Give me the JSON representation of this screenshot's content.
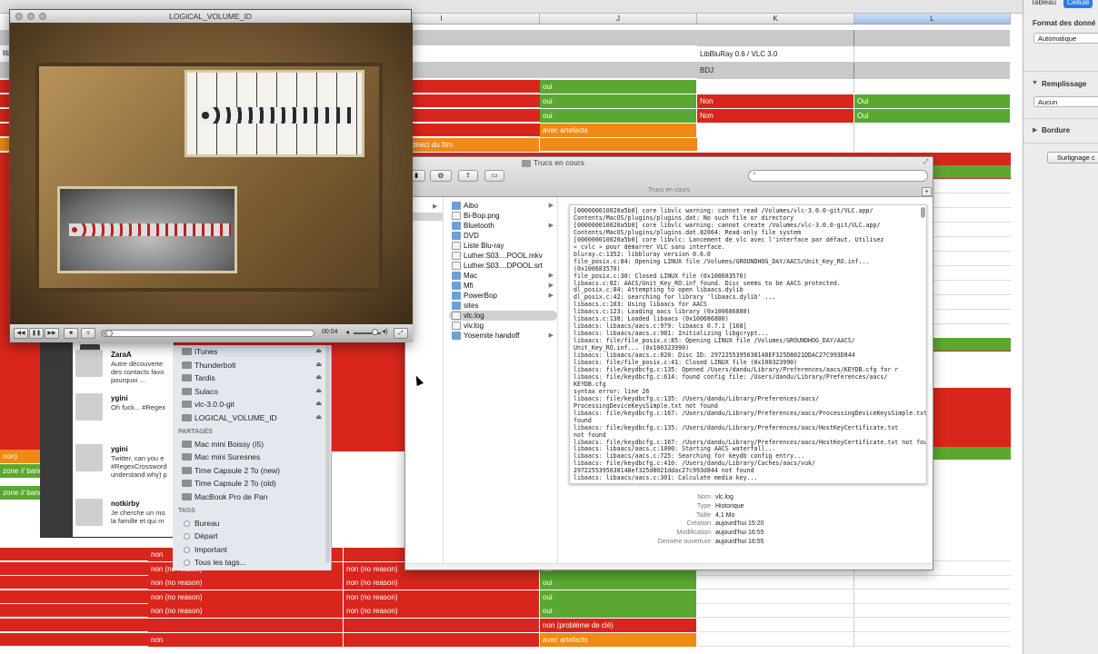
{
  "spreadsheet": {
    "columns": [
      "I",
      "J",
      "K",
      "L"
    ],
    "header_rows": {
      "libbluray_label": "LibBluRay 0.6 / VLC 3.0",
      "bdj_label": "BDJ",
      "lib_fragment": "lib"
    },
    "j_cells": [
      "oui",
      "oui",
      "oui",
      "avec artefacts"
    ],
    "i_cell_direct": "direct du film",
    "k_cells": [
      "Non",
      "Non"
    ],
    "l_cells": [
      "Oui",
      "Oui"
    ],
    "left_fragments": [
      "non)",
      "zone // bande",
      "zone // bande"
    ],
    "bottom_rows": [
      {
        "h": "non",
        "i": "",
        "j": "oui"
      },
      {
        "h": "non (no reason)",
        "i": "non (no reason)",
        "j": "oui"
      },
      {
        "h": "non (no reason)",
        "i": "non (no reason)",
        "j": "oui"
      },
      {
        "h": "non (no reason)",
        "i": "non (no reason)",
        "j": "oui"
      },
      {
        "h": "non (no reason)",
        "i": "non (no reason)",
        "j": "oui"
      },
      {
        "h": "",
        "i": "",
        "j": "non (problème de clé)"
      },
      {
        "h": "non",
        "i": "",
        "j": "avec artefacts"
      }
    ]
  },
  "inspector": {
    "tabs": [
      "Tableau",
      "Cellule"
    ],
    "data_format_label": "Format des donné",
    "data_format_value": "Automatique",
    "fill_label": "Remplissage",
    "fill_value": "Aucun",
    "border_label": "Bordure",
    "highlight_button": "Surlignage c"
  },
  "vlc": {
    "title": "LOGICAL_VOLUME_ID",
    "time": "00:04",
    "progress": 0.02
  },
  "finder": {
    "title": "Trucs en cours",
    "path_label": "Trucs en cours",
    "search_placeholder": "",
    "items": [
      {
        "name": "Aibo",
        "folder": true,
        "arrow": true
      },
      {
        "name": "Bi-Bop.png",
        "folder": false
      },
      {
        "name": "Bluetooth",
        "folder": true,
        "arrow": true
      },
      {
        "name": "DVD",
        "folder": true
      },
      {
        "name": "Liste Blu-ray",
        "folder": false
      },
      {
        "name": "Luther.S03....POOL.mkv",
        "folder": false
      },
      {
        "name": "Luther.S03....DPOOL.srt",
        "folder": false
      },
      {
        "name": "Mac",
        "folder": true,
        "arrow": true
      },
      {
        "name": "Mfi",
        "folder": true,
        "arrow": true
      },
      {
        "name": "PowerBop",
        "folder": true,
        "arrow": true
      },
      {
        "name": "sites",
        "folder": true
      },
      {
        "name": "vlc.log",
        "folder": false,
        "selected": true
      },
      {
        "name": "viv.log",
        "folder": false
      },
      {
        "name": "Yosemite handoff",
        "folder": true,
        "arrow": true
      }
    ],
    "log_lines": [
      "[000000010020a5b0] core libvlc warning: cannot read /Volumes/vlc-3.0.0-git/VLC.app/",
      "Contents/MacOS/plugins/plugins.dat: No such file or directory",
      "[000000010020a5b0] core libvlc warning: cannot create /Volumes/vlc-3.0.0-git/VLC.app/",
      "Contents/MacOS/plugins/plugins.dat.82064: Read-only file system",
      "[000000010020a5b0] core libvlc: Lancement de vlc avec l'interface par défaut. Utilisez",
      "« cvlc » pour démarrer VLC sans interface.",
      "bluray.c:1352: libbluray version 0.6.0",
      "file_posix.c:84: Opening LINUX file /Volumes/GROUNDHOG_DAY/AACS/Unit_Key_RO.inf...",
      "(0x100683570)",
      "file_posix.c:30: Closed LINUX file (0x100683570)",
      "libaacs.c:82: AACS/Unit_Key_RO.inf found. Disc seems to be AACS protected.",
      "dl_posix.c:84: Attempting to open libaacs.dylib",
      "dl_posix.c:42: searching for library 'libaacs.dylib' ...",
      "libaacs.c:103: Using libaacs for AACS",
      "libaacs.c:123: Loading aacs library (0x100686880)",
      "libaacs.c:138: Loaded libaacs (0x100686880)",
      "libaacs: libaacs/aacs.c:979: libaacs 0.7.1 [168]",
      "libaacs: libaacs/aacs.c:981: Initializing libgcrypt...",
      "libaacs: file/file_posix.c:85: Opening LINUX file /Volumes/GROUNDHOG_DAY/AACS/",
      "Unit_Key_RO.inf... (0x100323990)",
      "libaacs: libaacs/aacs.c:820: Disc ID: 2972255395638148EF325D8021DDAC27C993D844",
      "libaacs: file/file_posix.c:41: Closed LINUX file (0x100323990)",
      "libaacs: file/keydbcfg.c:135: Opened /Users/dandu/Library/Preferences/aacs/KEYDB.cfg for r",
      "libaacs: file/keydbcfg.c:614: found config file: /Users/dandu/Library/Preferences/aacs/",
      "KEYDB.cfg",
      "syntax error: line 26",
      "libaacs: file/keydbcfg.c:135: /Users/dandu/Library/Preferences/aacs/",
      "ProcessingDeviceKeysSimple.txt not found",
      "libaacs: file/keydbcfg.c:167: /Users/dandu/Library/Preferences/aacs/ProcessingDeviceKeysSimple.txt not",
      "found",
      "libaacs: file/keydbcfg.c:135: /Users/dandu/Library/Preferences/aacs/HostKeyCertificate.txt",
      "not found",
      "libaacs: file/keydbcfg.c:167: /Users/dandu/Library/Preferences/aacs/HostKeyCertificate.txt not found",
      "libaacs: libaacs/aacs.c:1000: Starting AACS waterfall...",
      "libaacs: libaacs/aacs.c:725: Searching for keydb config entry...",
      "libaacs: file/keydbcfg.c:410: /Users/dandu/Library/Caches/aacs/vuk/",
      "2972255395638148ef325d8021ddac27c993d844 not found",
      "libaacs: libaacs/aacs.c:301: Calculate media key..."
    ],
    "info": [
      {
        "label": "Nom",
        "value": "vlc.log"
      },
      {
        "label": "Type",
        "value": "Historique"
      },
      {
        "label": "Taille",
        "value": "4,1 Mo"
      },
      {
        "label": "Création",
        "value": "aujourd'hui 15:20"
      },
      {
        "label": "Modification",
        "value": "aujourd'hui 16:55"
      },
      {
        "label": "Dernière ouverture",
        "value": "aujourd'hui 16:55"
      }
    ]
  },
  "sidebar": {
    "devices": [
      {
        "name": "iTunes"
      },
      {
        "name": "Thunderbolt"
      },
      {
        "name": "Tardis"
      },
      {
        "name": "Sulaco"
      },
      {
        "name": "vlc-3.0.0-git"
      },
      {
        "name": "LOGICAL_VOLUME_ID"
      }
    ],
    "shared_header": "PARTAGÉS",
    "shared": [
      "Mac mini Boissy (i5)",
      "Mac mini Suresnes",
      "Time Capsule 2 To (new)",
      "Time Capsule 2 To (old)",
      "MacBook Pro de Pan"
    ],
    "tags_header": "TAGS",
    "tags": [
      "Bureau",
      "Départ",
      "Important",
      "Tous les tags..."
    ]
  },
  "twitter": {
    "tweets": [
      {
        "user": "ZaraA",
        "text": "Autre découverte\ndes contacts favo\npourquoi ..."
      },
      {
        "user": "ygini",
        "text": "Oh fuck... #Regex"
      },
      {
        "user": "ygini",
        "text": "Twitter, can you e\n#RegexCrossword\nunderstand why) p"
      },
      {
        "user": "notkirby",
        "text": "Je cherche un mo\nla famille et qui m"
      }
    ]
  }
}
